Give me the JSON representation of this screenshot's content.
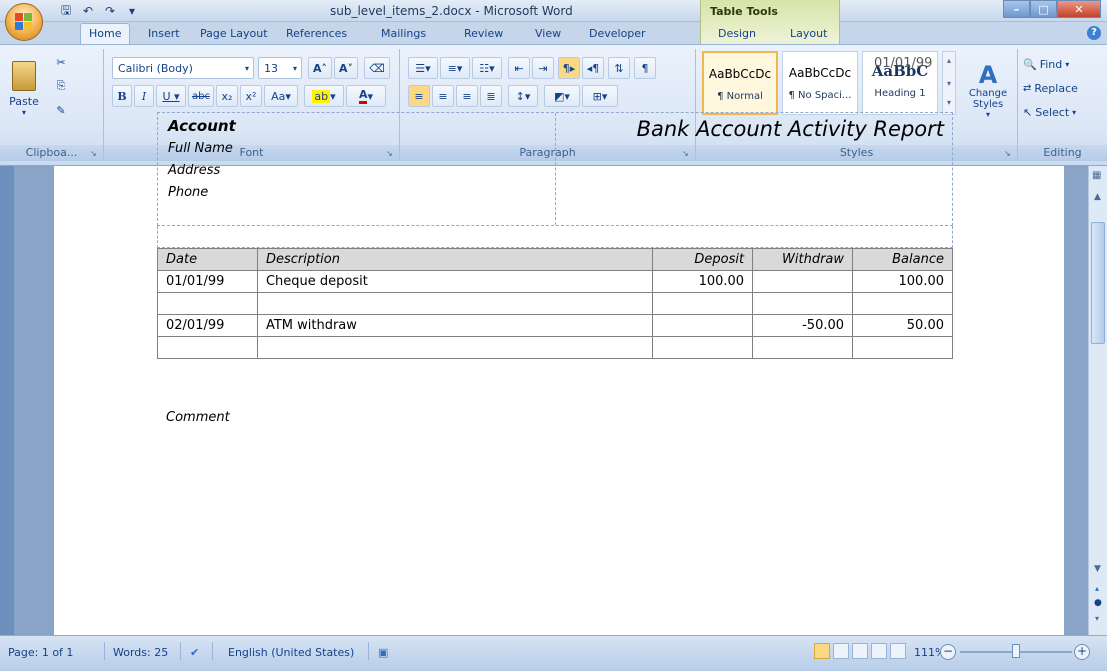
{
  "window": {
    "title": "sub_level_items_2.docx - Microsoft Word",
    "context_tab_group": "Table Tools"
  },
  "tabs": [
    "Home",
    "Insert",
    "Page Layout",
    "References",
    "Mailings",
    "Review",
    "View",
    "Developer",
    "Design",
    "Layout"
  ],
  "ribbon": {
    "clipboard": {
      "label": "Clipboa...",
      "paste": "Paste"
    },
    "font": {
      "label": "Font",
      "name": "Calibri (Body)",
      "size": "13"
    },
    "paragraph": {
      "label": "Paragraph"
    },
    "styles": {
      "label": "Styles",
      "items": [
        {
          "sample": "AaBbCcDc",
          "name": "¶ Normal"
        },
        {
          "sample": "AaBbCcDc",
          "name": "¶ No Spaci..."
        },
        {
          "sample": "AaBbC",
          "name": "Heading 1"
        }
      ],
      "change_styles": "Change Styles"
    },
    "editing": {
      "label": "Editing",
      "find": "Find",
      "replace": "Replace",
      "select": "Select"
    }
  },
  "document": {
    "date": "01/01/99",
    "account": {
      "title": "Account",
      "full_name": "Full Name",
      "address": "Address",
      "phone": "Phone"
    },
    "report_title": "Bank Account Activity Report",
    "table": {
      "headers": [
        "Date",
        "Description",
        "Deposit",
        "Withdraw",
        "Balance"
      ],
      "rows": [
        {
          "date": "01/01/99",
          "description": "Cheque deposit",
          "deposit": "100.00",
          "withdraw": "",
          "balance": "100.00"
        },
        {
          "date": "02/01/99",
          "description": "ATM withdraw",
          "deposit": "",
          "withdraw": "-50.00",
          "balance": "50.00"
        }
      ]
    },
    "comment": "Comment"
  },
  "status": {
    "page": "Page: 1 of 1",
    "words": "Words: 25",
    "language": "English (United States)",
    "zoom": "111%"
  }
}
